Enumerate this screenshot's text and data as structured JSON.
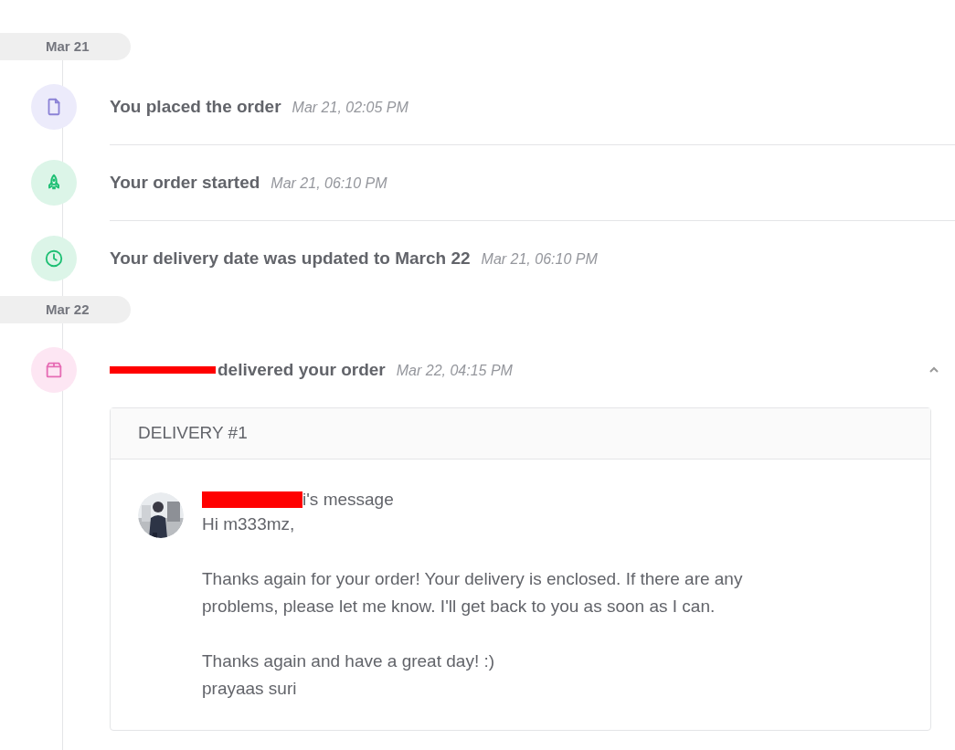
{
  "groups": [
    {
      "date": "Mar 21",
      "events": [
        {
          "kind": "document",
          "text": "You placed the order",
          "time": "Mar 21, 02:05 PM"
        },
        {
          "kind": "rocket",
          "text": "Your order started",
          "time": "Mar 21, 06:10 PM"
        },
        {
          "kind": "clock",
          "text": "Your delivery date was updated to March 22",
          "time": "Mar 21, 06:10 PM"
        }
      ]
    },
    {
      "date": "Mar 22",
      "events": [
        {
          "kind": "delivery",
          "redacted_actor": true,
          "text": "delivered your order",
          "time": "Mar 22, 04:15 PM",
          "expanded": true,
          "delivery": {
            "title": "DELIVERY #1",
            "message_title": "i's message",
            "paragraphs": [
              "Hi m333mz,",
              "Thanks again for your order! Your delivery is enclosed. If there are any problems, please let me know. I'll get back to you as soon as I can.",
              "Thanks again and have a great day! :)\nprayaas suri"
            ]
          }
        }
      ]
    }
  ]
}
